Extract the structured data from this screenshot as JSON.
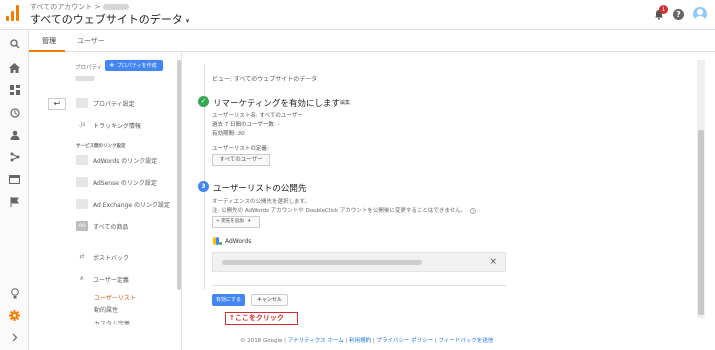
{
  "header": {
    "breadcrumb": "すべてのアカウント >",
    "view_title": "すべてのウェブサイトのデータ",
    "caret": "▾",
    "notification_count": "1"
  },
  "rail": {
    "icons": [
      "search-icon",
      "home-icon",
      "dashboard-icon",
      "clock-icon",
      "person-icon",
      "acquisition-icon",
      "behavior-icon",
      "flag-icon",
      "lightbulb-icon",
      "gear-icon",
      "expand-icon"
    ]
  },
  "tabs": [
    "管理",
    "ユーザー"
  ],
  "admin": {
    "property_label": "プロパティ",
    "create_property": "プロパティを作成",
    "back": "↩",
    "menu_items": [
      "プロパティ設定",
      "トラッキング情報"
    ],
    "section_header": "サービス間のリンク設定",
    "link_items": [
      "AdWords のリンク設定",
      "AdSense のリンク設定",
      "Ad Exchange のリンク設定",
      "すべての商品"
    ],
    "postback": "ポストバック",
    "audience_definitions": "ユーザー定義",
    "sub_items": [
      "ユーザーリスト",
      "動的属性",
      "カスタム定義"
    ]
  },
  "main": {
    "view_line": "ビュー: すべてのウェブサイトのデータ",
    "step2": {
      "number": "✓",
      "title": "リマーケティングを有効にします",
      "edit": "編集",
      "list_name": "ユーザーリスト名: すべてのユーザー",
      "users_prefix": "過去 7 日間のユーザー数: ",
      "users_value": "-",
      "duration_prefix": "有効期間: ",
      "duration_value": "30",
      "definition_label": "ユーザーリストの定義:",
      "definition_button": "すべてのユーザー"
    },
    "step3": {
      "number": "3",
      "title": "ユーザーリストの公開先",
      "desc1": "オーディエンスの公開先を選択します。",
      "desc2": "注: 公開先の AdWords アカウントや DoubleClick アカウントを公開後に変更することはできません。",
      "add_destination": "+ 宛先を追加",
      "add_caret": "▾",
      "adwords_label": "AdWords",
      "close": "×"
    },
    "enable_button": "有効にする",
    "cancel_button": "キャンセル"
  },
  "annotation": "↑ここをクリック",
  "footer": {
    "copyright": "© 2018 Google | ",
    "links": [
      "アナリティクス ホーム",
      "利用規約",
      "プライバシー ポリシー",
      "フィードバックを送信"
    ],
    "separator": " | "
  },
  "colors": {
    "accent": "#f57c00",
    "primary_button": "#4285f4",
    "success": "#34a853",
    "annotation": "#d32f2f"
  }
}
